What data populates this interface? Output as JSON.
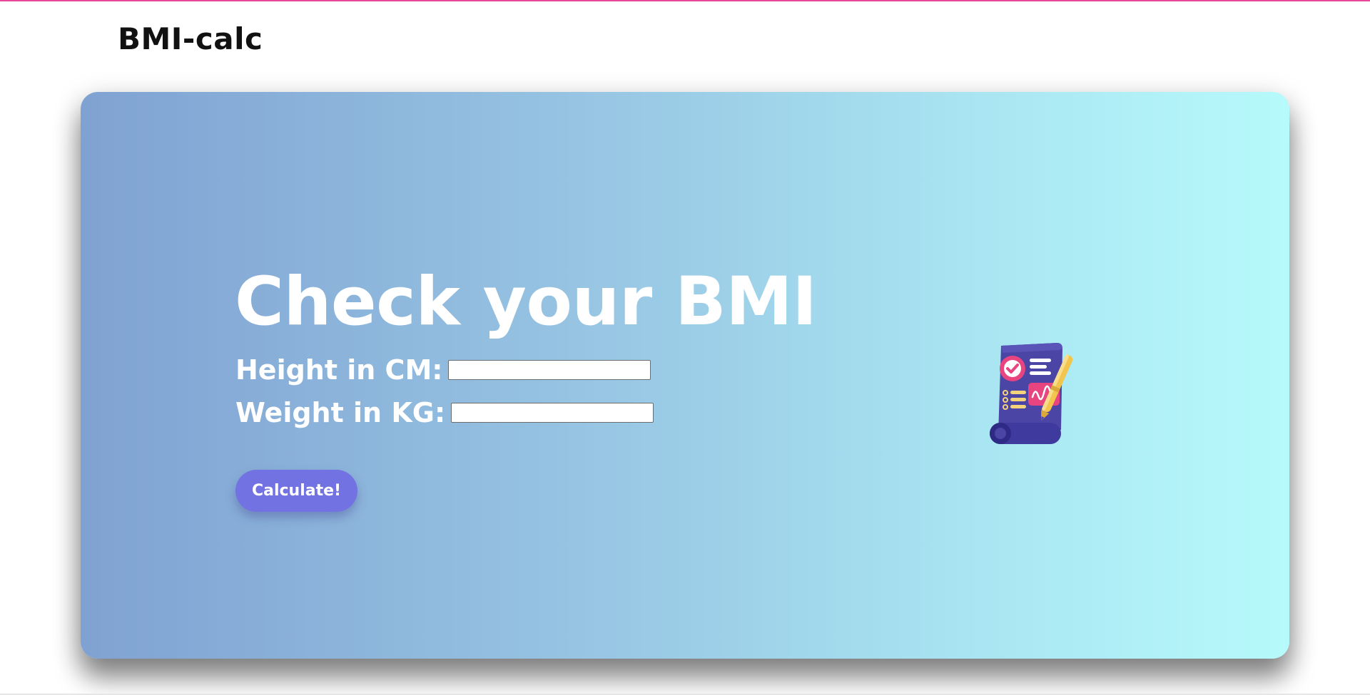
{
  "app": {
    "brand": "BMI-calc"
  },
  "hero": {
    "title": "Check your BMI"
  },
  "form": {
    "height_label": "Height in CM:",
    "height_value": "",
    "weight_label": "Weight in KG:",
    "weight_value": "",
    "submit_label": "Calculate!"
  },
  "illustration": {
    "icon": "report-document-pen-icon"
  },
  "colors": {
    "accent": "#e8479a",
    "button": "#7272e2",
    "gradient_start": "#80a2d2",
    "gradient_end": "#b6fafb",
    "doc_body": "#4b45a6",
    "doc_badge": "#e8447f",
    "doc_lines": "#f4d37a",
    "pen": "#f2c54f"
  }
}
